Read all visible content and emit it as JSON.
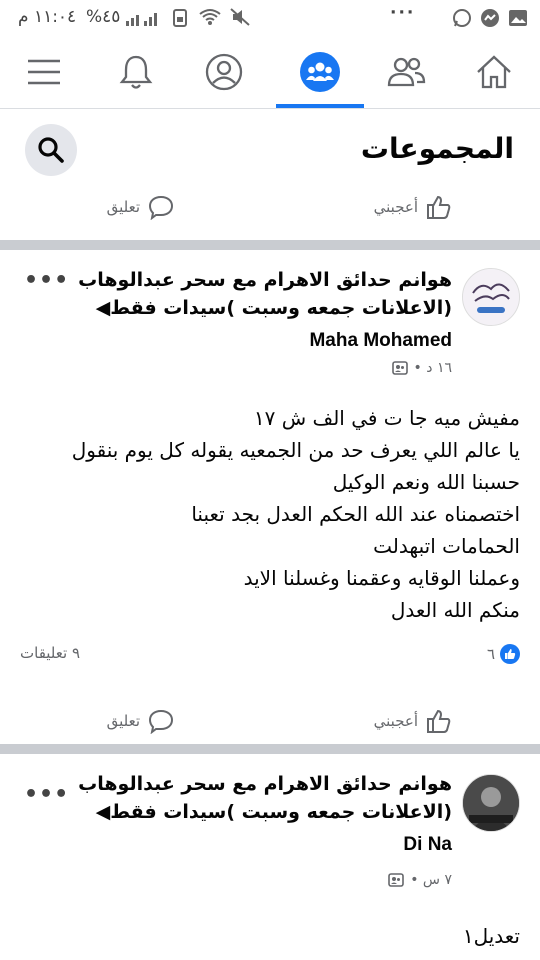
{
  "status_bar": {
    "time": "١١:٠٤ م",
    "battery": "%٤٥"
  },
  "nav": {
    "tabs": [
      {
        "name": "menu"
      },
      {
        "name": "notifications"
      },
      {
        "name": "profile"
      },
      {
        "name": "groups",
        "active": true
      },
      {
        "name": "friends"
      },
      {
        "name": "home"
      }
    ],
    "accent_color": "#1877f2"
  },
  "header": {
    "title": "المجموعات"
  },
  "actions": {
    "like": "أعجبني",
    "comment": "تعليق"
  },
  "posts": [
    {
      "group": "هوانم حدائق الاهرام  مع سحر عبدالوهاب (الاعلانات جمعه وسبت )سيدات فقط◀",
      "author": "Maha Mohamed",
      "time": "١٦ د •",
      "lines": [
        "مفيش ميه جا ت في الف ش ١٧",
        "يا عالم اللي يعرف حد من الجمعيه يقوله كل يوم بنقول",
        "حسبنا الله ونعم الوكيل",
        "اختصمناه عند الله الحكم العدل بجد تعبنا",
        "الحمامات اتبهدلت",
        "وعملنا الوقايه وعقمنا وغسلنا الايد",
        "منكم الله العدل"
      ],
      "likes": "٦",
      "comments": "٩ تعليقات"
    },
    {
      "group": "هوانم حدائق الاهرام  مع سحر عبدالوهاب (الاعلانات جمعه وسبت )سيدات فقط◀",
      "author": "Di Na",
      "time": "٧ س •",
      "lines": [
        "تعديل١"
      ]
    }
  ]
}
